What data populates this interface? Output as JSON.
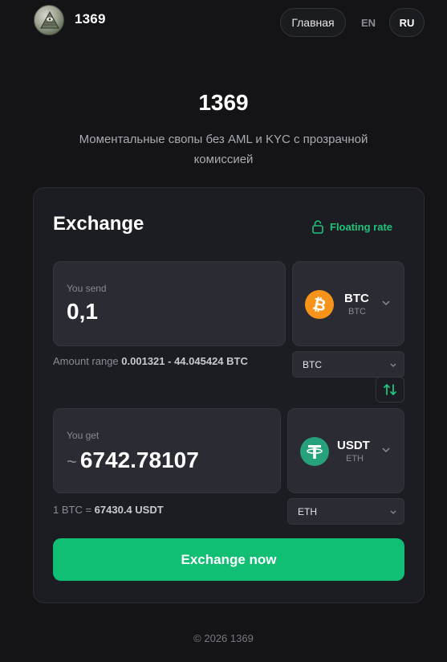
{
  "header": {
    "brand": "1369",
    "nav_home": "Главная",
    "lang_en": "EN",
    "lang_ru": "RU"
  },
  "hero": {
    "title": "1369",
    "subtitle": "Моментальные свопы без AML и KYC с прозрачной комиссией"
  },
  "exchange": {
    "title": "Exchange",
    "rate_label": "Floating rate",
    "send": {
      "label": "You send",
      "value": "0,1",
      "coin_symbol": "BTC",
      "coin_network": "BTC",
      "network_select": "BTC",
      "range_prefix": "Amount range",
      "range_value": "0.001321 - 44.045424 BTC"
    },
    "get": {
      "label": "You get",
      "approx": "~",
      "value": "6742.78107",
      "coin_symbol": "USDT",
      "coin_network": "ETH",
      "network_select": "ETH",
      "rate_prefix": "1 BTC =",
      "rate_value": "67430.4 USDT"
    },
    "cta": "Exchange now"
  },
  "footer": {
    "text": "© 2026 1369"
  },
  "colors": {
    "accent": "#10bf74",
    "btc": "#f7931a",
    "usdt": "#26a17b",
    "background": "#141417"
  }
}
